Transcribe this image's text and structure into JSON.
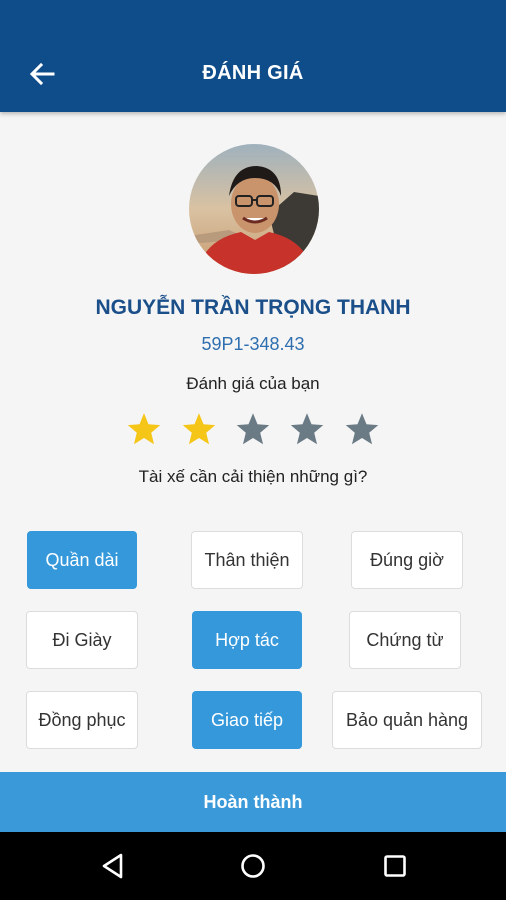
{
  "header": {
    "title": "ĐÁNH GIÁ",
    "back_icon": "arrow-left-icon",
    "background": "#0f4c8a"
  },
  "driver": {
    "name": "NGUYỄN TRẦN TRỌNG THANH",
    "plate": "59P1-348.43",
    "avatar": "driver-photo"
  },
  "rating": {
    "label": "Đánh giá của bạn",
    "value": 2,
    "max": 5,
    "active_color": "#f5c518",
    "inactive_color": "#6b7b86"
  },
  "improvement": {
    "question": "Tài xế cần cải thiện những gì?",
    "options": [
      {
        "label": "Quần dài",
        "selected": true
      },
      {
        "label": "Thân thiện",
        "selected": false
      },
      {
        "label": "Đúng giờ",
        "selected": false
      },
      {
        "label": "Đi Giày",
        "selected": false
      },
      {
        "label": "Hợp tác",
        "selected": true
      },
      {
        "label": "Chứng từ",
        "selected": false
      },
      {
        "label": "Đồng phục",
        "selected": false
      },
      {
        "label": "Giao tiếp",
        "selected": true
      },
      {
        "label": "Bảo quản hàng",
        "selected": false
      }
    ],
    "selected_color": "#3498db"
  },
  "submit": {
    "label": "Hoàn thành",
    "background": "#3a9ad9"
  },
  "system_nav": {
    "back_icon": "nav-back-triangle-icon",
    "home_icon": "nav-home-circle-icon",
    "recents_icon": "nav-recents-square-icon"
  }
}
